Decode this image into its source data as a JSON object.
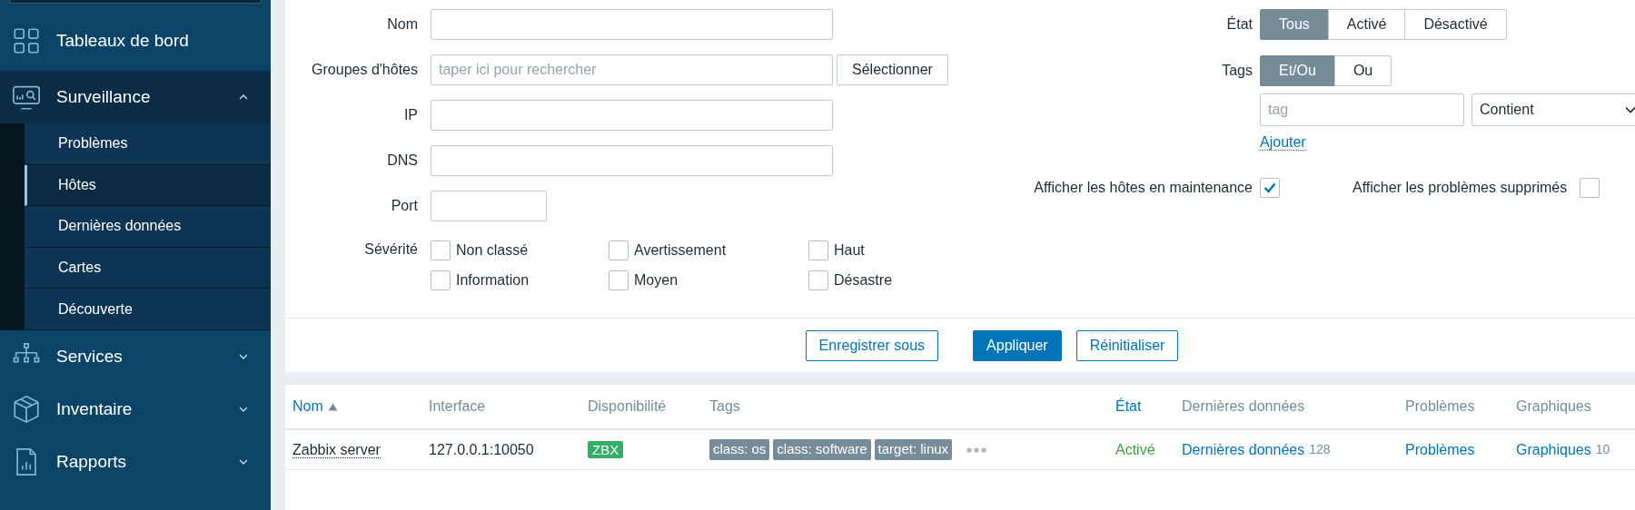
{
  "sidebar": {
    "items": [
      {
        "label": "Tableaux de bord",
        "kind": "link"
      },
      {
        "label": "Surveillance",
        "kind": "group",
        "expanded": true,
        "children": [
          {
            "label": "Problèmes",
            "selected": false
          },
          {
            "label": "Hôtes",
            "selected": true
          },
          {
            "label": "Dernières données",
            "selected": false
          },
          {
            "label": "Cartes",
            "selected": false
          },
          {
            "label": "Découverte",
            "selected": false
          }
        ]
      },
      {
        "label": "Services",
        "kind": "group",
        "expanded": false
      },
      {
        "label": "Inventaire",
        "kind": "group",
        "expanded": false
      },
      {
        "label": "Rapports",
        "kind": "group",
        "expanded": false
      }
    ]
  },
  "filter": {
    "fields": [
      {
        "label": "Nom",
        "kind": "text"
      },
      {
        "label": "Groupes d'hôtes",
        "kind": "multiselect",
        "placeholder": "taper ici pour rechercher",
        "button": "Sélectionner"
      },
      {
        "label": "IP",
        "kind": "text"
      },
      {
        "label": "DNS",
        "kind": "text"
      },
      {
        "label": "Port",
        "kind": "short"
      }
    ],
    "severity": {
      "label": "Sévérité",
      "options": [
        {
          "label": "Non classé",
          "checked": false
        },
        {
          "label": "Avertissement",
          "checked": false
        },
        {
          "label": "Haut",
          "checked": false
        },
        {
          "label": "Information",
          "checked": false
        },
        {
          "label": "Moyen",
          "checked": false
        },
        {
          "label": "Désastre",
          "checked": false
        }
      ]
    },
    "state": {
      "label": "État",
      "options": [
        {
          "label": "Tous",
          "selected": true
        },
        {
          "label": "Activé",
          "selected": false
        },
        {
          "label": "Désactivé",
          "selected": false
        }
      ]
    },
    "tags": {
      "label": "Tags",
      "modes": [
        {
          "label": "Et/Ou",
          "selected": true
        },
        {
          "label": "Ou",
          "selected": false
        }
      ],
      "rows": [
        {
          "placeholder": "tag",
          "operator": "Contient"
        }
      ],
      "add_link": "Ajouter"
    },
    "toggles": [
      {
        "label": "Afficher les hôtes en maintenance",
        "checked": true
      },
      {
        "label": "Afficher les problèmes supprimés",
        "checked": false
      }
    ],
    "actions": [
      {
        "label": "Enregistrer sous",
        "kind": "secondary"
      },
      {
        "label": "Appliquer",
        "kind": "primary"
      },
      {
        "label": "Réinitialiser",
        "kind": "secondary"
      }
    ]
  },
  "table": {
    "columns": [
      {
        "label": "Nom",
        "sortable": true,
        "sorted": true
      },
      {
        "label": "Interface",
        "sortable": false,
        "sorted": false
      },
      {
        "label": "Disponibilité",
        "sortable": false,
        "sorted": false
      },
      {
        "label": "Tags",
        "sortable": false,
        "sorted": false
      },
      {
        "label": "État",
        "sortable": true,
        "sorted": false
      },
      {
        "label": "Dernières données",
        "sortable": false,
        "sorted": false
      },
      {
        "label": "Problèmes",
        "sortable": false,
        "sorted": false
      },
      {
        "label": "Graphiques",
        "sortable": false,
        "sorted": false
      }
    ],
    "rows": [
      {
        "name": "Zabbix server",
        "interface": "127.0.0.1:10050",
        "availability": {
          "label": "ZBX",
          "color": "#34af67"
        },
        "tags": [
          "class: os",
          "class: software",
          "target: linux"
        ],
        "more_tags": true,
        "state": {
          "label": "Activé",
          "kind": "enabled"
        },
        "latest": {
          "label": "Dernières données",
          "count": "128"
        },
        "problems": {
          "label": "Problèmes"
        },
        "graphs": {
          "label": "Graphiques",
          "count": "10"
        }
      }
    ]
  }
}
